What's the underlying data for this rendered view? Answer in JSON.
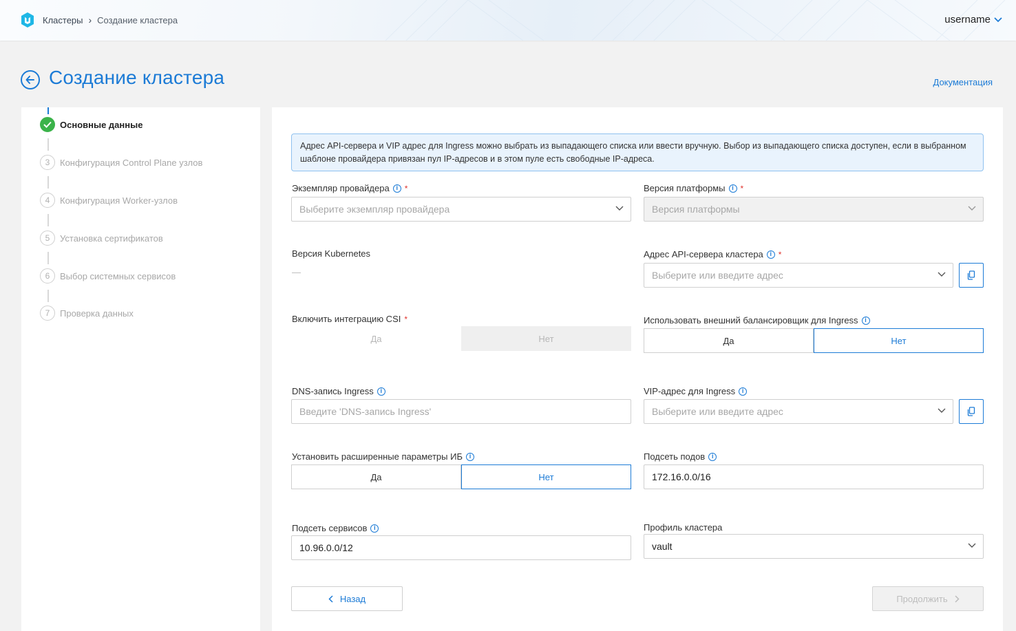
{
  "header": {
    "breadcrumb": [
      "Кластеры",
      "Создание кластера"
    ],
    "user": "username"
  },
  "page": {
    "title": "Создание кластера",
    "doc_link": "Документация"
  },
  "steps": [
    {
      "num": "",
      "label": "Основные данные",
      "state": "done"
    },
    {
      "num": "3",
      "label": "Конфигурация Control Plane узлов",
      "state": "pending"
    },
    {
      "num": "4",
      "label": "Конфигурация Worker-узлов",
      "state": "pending"
    },
    {
      "num": "5",
      "label": "Установка сертификатов",
      "state": "pending"
    },
    {
      "num": "6",
      "label": "Выбор системных сервисов",
      "state": "pending"
    },
    {
      "num": "7",
      "label": "Проверка данных",
      "state": "pending"
    }
  ],
  "info_text": "Адрес API-сервера и VIP адрес для Ingress можно выбрать из выпадающего списка или ввести вручную. Выбор из выпадающего списка доступен, если в выбранном шаблоне провайдера привязан пул IP-адресов и в этом пуле есть свободные IP-адреса.",
  "form": {
    "provider_instance": {
      "label": "Экземпляр провайдера",
      "required": "*",
      "placeholder": "Выберите экземпляр провайдера"
    },
    "platform_version": {
      "label": "Версия платформы",
      "required": "*",
      "placeholder": "Версия платформы"
    },
    "kubernetes_version": {
      "label": "Версия Kubernetes",
      "value": "—"
    },
    "api_server_address": {
      "label": "Адрес API-сервера кластера",
      "required": "*",
      "placeholder": "Выберите или введите адрес"
    },
    "csi": {
      "label": "Включить интеграцию CSI",
      "required": "*",
      "yes": "Да",
      "no": "Нет",
      "selected": "no"
    },
    "external_lb": {
      "label": "Использовать внешний балансировщик для Ingress",
      "yes": "Да",
      "no": "Нет",
      "selected": "no"
    },
    "dns_ingress": {
      "label": "DNS-запись Ingress",
      "placeholder": "Введите 'DNS-запись Ingress'"
    },
    "vip_ingress": {
      "label": "VIP-адрес для Ingress",
      "placeholder": "Выберите или введите адрес"
    },
    "security_params": {
      "label": "Установить расширенные параметры ИБ",
      "yes": "Да",
      "no": "Нет",
      "selected": "no"
    },
    "pod_subnet": {
      "label": "Подсеть подов",
      "value": "172.16.0.0/16"
    },
    "service_subnet": {
      "label": "Подсеть сервисов",
      "value": "10.96.0.0/12"
    },
    "cluster_profile": {
      "label": "Профиль кластера",
      "value": "vault"
    }
  },
  "buttons": {
    "back": "Назад",
    "next": "Продолжить"
  },
  "colors": {
    "accent": "#1c7bd6",
    "success": "#3bb34a",
    "required": "#e0342e"
  }
}
